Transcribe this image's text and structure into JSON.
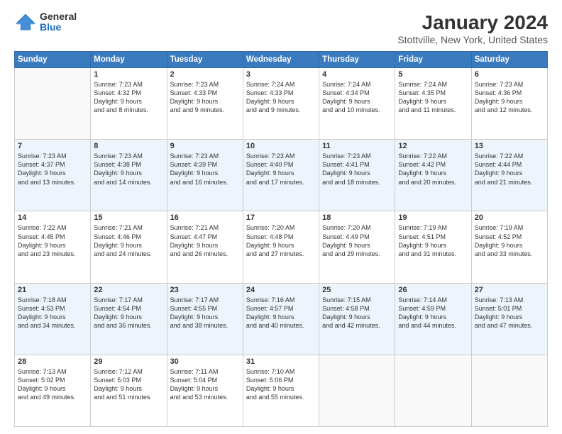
{
  "logo": {
    "general": "General",
    "blue": "Blue"
  },
  "title": "January 2024",
  "location": "Stottville, New York, United States",
  "days_of_week": [
    "Sunday",
    "Monday",
    "Tuesday",
    "Wednesday",
    "Thursday",
    "Friday",
    "Saturday"
  ],
  "weeks": [
    [
      {
        "day": "",
        "sunrise": "",
        "sunset": "",
        "daylight": ""
      },
      {
        "day": "1",
        "sunrise": "Sunrise: 7:23 AM",
        "sunset": "Sunset: 4:32 PM",
        "daylight": "Daylight: 9 hours and 8 minutes."
      },
      {
        "day": "2",
        "sunrise": "Sunrise: 7:23 AM",
        "sunset": "Sunset: 4:33 PM",
        "daylight": "Daylight: 9 hours and 9 minutes."
      },
      {
        "day": "3",
        "sunrise": "Sunrise: 7:24 AM",
        "sunset": "Sunset: 4:33 PM",
        "daylight": "Daylight: 9 hours and 9 minutes."
      },
      {
        "day": "4",
        "sunrise": "Sunrise: 7:24 AM",
        "sunset": "Sunset: 4:34 PM",
        "daylight": "Daylight: 9 hours and 10 minutes."
      },
      {
        "day": "5",
        "sunrise": "Sunrise: 7:24 AM",
        "sunset": "Sunset: 4:35 PM",
        "daylight": "Daylight: 9 hours and 11 minutes."
      },
      {
        "day": "6",
        "sunrise": "Sunrise: 7:23 AM",
        "sunset": "Sunset: 4:36 PM",
        "daylight": "Daylight: 9 hours and 12 minutes."
      }
    ],
    [
      {
        "day": "7",
        "sunrise": "Sunrise: 7:23 AM",
        "sunset": "Sunset: 4:37 PM",
        "daylight": "Daylight: 9 hours and 13 minutes."
      },
      {
        "day": "8",
        "sunrise": "Sunrise: 7:23 AM",
        "sunset": "Sunset: 4:38 PM",
        "daylight": "Daylight: 9 hours and 14 minutes."
      },
      {
        "day": "9",
        "sunrise": "Sunrise: 7:23 AM",
        "sunset": "Sunset: 4:39 PM",
        "daylight": "Daylight: 9 hours and 16 minutes."
      },
      {
        "day": "10",
        "sunrise": "Sunrise: 7:23 AM",
        "sunset": "Sunset: 4:40 PM",
        "daylight": "Daylight: 9 hours and 17 minutes."
      },
      {
        "day": "11",
        "sunrise": "Sunrise: 7:23 AM",
        "sunset": "Sunset: 4:41 PM",
        "daylight": "Daylight: 9 hours and 18 minutes."
      },
      {
        "day": "12",
        "sunrise": "Sunrise: 7:22 AM",
        "sunset": "Sunset: 4:42 PM",
        "daylight": "Daylight: 9 hours and 20 minutes."
      },
      {
        "day": "13",
        "sunrise": "Sunrise: 7:22 AM",
        "sunset": "Sunset: 4:44 PM",
        "daylight": "Daylight: 9 hours and 21 minutes."
      }
    ],
    [
      {
        "day": "14",
        "sunrise": "Sunrise: 7:22 AM",
        "sunset": "Sunset: 4:45 PM",
        "daylight": "Daylight: 9 hours and 23 minutes."
      },
      {
        "day": "15",
        "sunrise": "Sunrise: 7:21 AM",
        "sunset": "Sunset: 4:46 PM",
        "daylight": "Daylight: 9 hours and 24 minutes."
      },
      {
        "day": "16",
        "sunrise": "Sunrise: 7:21 AM",
        "sunset": "Sunset: 4:47 PM",
        "daylight": "Daylight: 9 hours and 26 minutes."
      },
      {
        "day": "17",
        "sunrise": "Sunrise: 7:20 AM",
        "sunset": "Sunset: 4:48 PM",
        "daylight": "Daylight: 9 hours and 27 minutes."
      },
      {
        "day": "18",
        "sunrise": "Sunrise: 7:20 AM",
        "sunset": "Sunset: 4:49 PM",
        "daylight": "Daylight: 9 hours and 29 minutes."
      },
      {
        "day": "19",
        "sunrise": "Sunrise: 7:19 AM",
        "sunset": "Sunset: 4:51 PM",
        "daylight": "Daylight: 9 hours and 31 minutes."
      },
      {
        "day": "20",
        "sunrise": "Sunrise: 7:19 AM",
        "sunset": "Sunset: 4:52 PM",
        "daylight": "Daylight: 9 hours and 33 minutes."
      }
    ],
    [
      {
        "day": "21",
        "sunrise": "Sunrise: 7:18 AM",
        "sunset": "Sunset: 4:53 PM",
        "daylight": "Daylight: 9 hours and 34 minutes."
      },
      {
        "day": "22",
        "sunrise": "Sunrise: 7:17 AM",
        "sunset": "Sunset: 4:54 PM",
        "daylight": "Daylight: 9 hours and 36 minutes."
      },
      {
        "day": "23",
        "sunrise": "Sunrise: 7:17 AM",
        "sunset": "Sunset: 4:55 PM",
        "daylight": "Daylight: 9 hours and 38 minutes."
      },
      {
        "day": "24",
        "sunrise": "Sunrise: 7:16 AM",
        "sunset": "Sunset: 4:57 PM",
        "daylight": "Daylight: 9 hours and 40 minutes."
      },
      {
        "day": "25",
        "sunrise": "Sunrise: 7:15 AM",
        "sunset": "Sunset: 4:58 PM",
        "daylight": "Daylight: 9 hours and 42 minutes."
      },
      {
        "day": "26",
        "sunrise": "Sunrise: 7:14 AM",
        "sunset": "Sunset: 4:59 PM",
        "daylight": "Daylight: 9 hours and 44 minutes."
      },
      {
        "day": "27",
        "sunrise": "Sunrise: 7:13 AM",
        "sunset": "Sunset: 5:01 PM",
        "daylight": "Daylight: 9 hours and 47 minutes."
      }
    ],
    [
      {
        "day": "28",
        "sunrise": "Sunrise: 7:13 AM",
        "sunset": "Sunset: 5:02 PM",
        "daylight": "Daylight: 9 hours and 49 minutes."
      },
      {
        "day": "29",
        "sunrise": "Sunrise: 7:12 AM",
        "sunset": "Sunset: 5:03 PM",
        "daylight": "Daylight: 9 hours and 51 minutes."
      },
      {
        "day": "30",
        "sunrise": "Sunrise: 7:11 AM",
        "sunset": "Sunset: 5:04 PM",
        "daylight": "Daylight: 9 hours and 53 minutes."
      },
      {
        "day": "31",
        "sunrise": "Sunrise: 7:10 AM",
        "sunset": "Sunset: 5:06 PM",
        "daylight": "Daylight: 9 hours and 55 minutes."
      },
      {
        "day": "",
        "sunrise": "",
        "sunset": "",
        "daylight": ""
      },
      {
        "day": "",
        "sunrise": "",
        "sunset": "",
        "daylight": ""
      },
      {
        "day": "",
        "sunrise": "",
        "sunset": "",
        "daylight": ""
      }
    ]
  ]
}
